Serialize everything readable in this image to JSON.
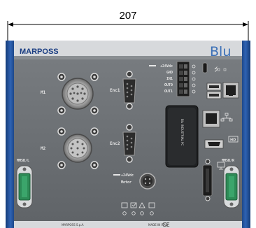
{
  "dimension": {
    "value": "207"
  },
  "brand": {
    "name": "MARPOSS",
    "model": "Blu"
  },
  "connectors": {
    "m1": "M1",
    "enc1": "Enc1",
    "m2": "M2",
    "enc2": "Enc2",
    "power": "+24Vdc",
    "motor": "Motor",
    "mmsb_left": "MMSB/L",
    "mmsb_right": "MMSB/R"
  },
  "io_labels": [
    "+24Vdc",
    "GND",
    "IN1",
    "OUT0",
    "OUT1"
  ],
  "vertical_label": "Blu INDUSTRIAL PC",
  "footer": {
    "left": "MARPOSS S.p.A.",
    "right": "MADE IN ITALY"
  },
  "colors": {
    "rail_blue": "#1f4f98",
    "panel_grey": "#6f7377",
    "brand_blue": "#1a3d82",
    "connector_green": "#2e8b57"
  }
}
